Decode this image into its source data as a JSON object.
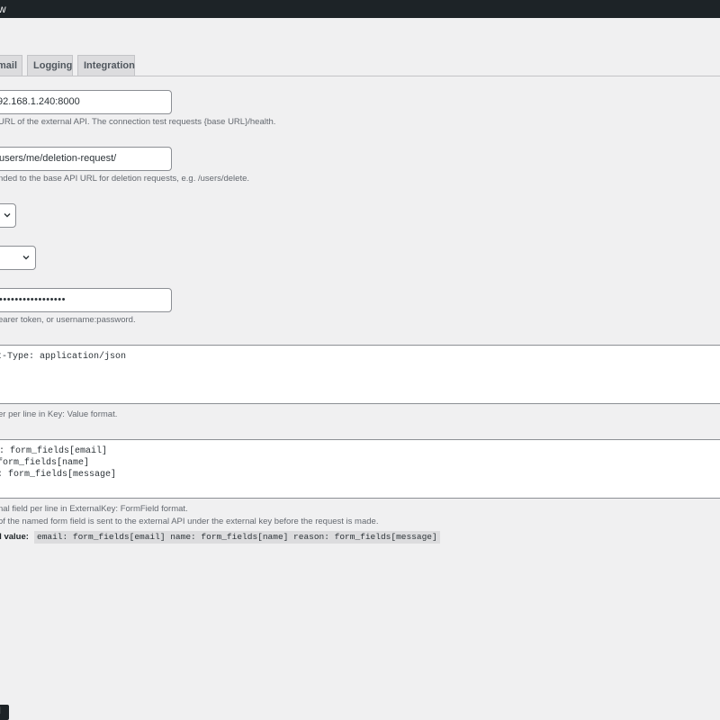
{
  "topbar": {
    "title": "w"
  },
  "tabs": [
    {
      "label": "mail"
    },
    {
      "label": "Logging"
    },
    {
      "label": "Integration"
    }
  ],
  "fields": {
    "base_url": {
      "value": "92.168.1.240:8000",
      "description": "URL of the external API. The connection test requests {base URL}/health."
    },
    "deletion_endpoint": {
      "value": "users/me/deletion-request/",
      "description": "nded to the base API URL for deletion requests, e.g. /users/delete."
    },
    "credentials": {
      "value": "•••••••••••••••••",
      "description": "earer token, or username:password."
    },
    "headers": {
      "lines": [
        "t-Type: application/json"
      ],
      "description": "er per line in Key: Value format."
    },
    "field_map": {
      "lines": [
        ": form_fields[email]",
        "form_fields[name]",
        ": form_fields[message]"
      ],
      "description_1": "nal field per line in ExternalKey: FormField format.",
      "description_2": "of the named form field is sent to the external API under the external key before the request is made.",
      "expected_label": "d value:",
      "expected_code": "email: form_fields[email] name: form_fields[name] reason: form_fields[message]"
    }
  },
  "corner": {
    "label": "l"
  },
  "colors": {
    "topbar": "#1d2327",
    "page_bg": "#f0f0f1",
    "input_border": "#8c8f94",
    "tab_bg": "#dcdcde"
  }
}
